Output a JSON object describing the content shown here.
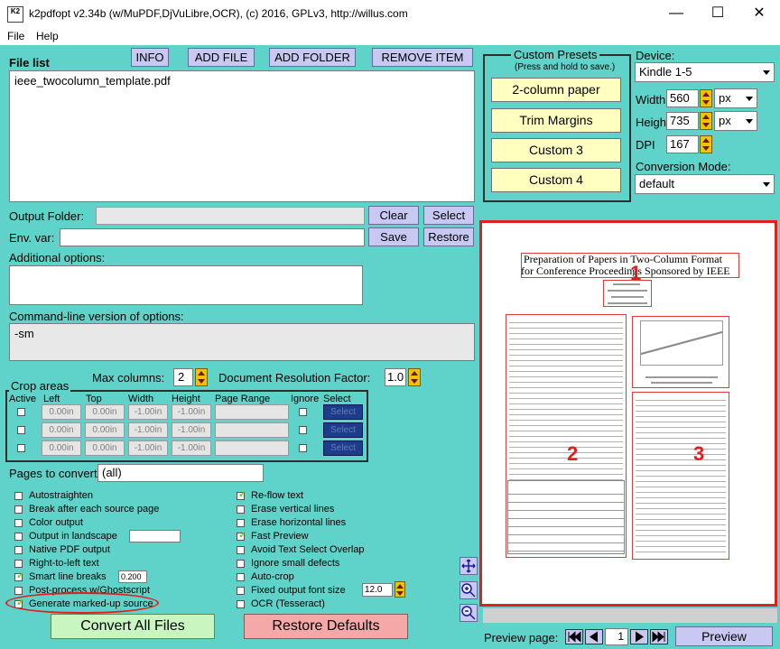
{
  "window": {
    "title": "k2pdfopt v2.34b (w/MuPDF,DjVuLibre,OCR), (c) 2016, GPLv3, http://willus.com",
    "icon": "K2",
    "controls": {
      "minimize": "—",
      "maximize": "☐",
      "close": "✕"
    }
  },
  "menu": {
    "file": "File",
    "help": "Help"
  },
  "toolbar": {
    "file_list_label": "File list",
    "info": "INFO",
    "add_file": "ADD FILE",
    "add_folder": "ADD FOLDER",
    "remove_item": "REMOVE ITEM"
  },
  "file_list": [
    "ieee_twocolumn_template.pdf"
  ],
  "output_folder": {
    "label": "Output Folder:",
    "value": "",
    "clear": "Clear",
    "select": "Select"
  },
  "env_var": {
    "label": "Env. var:",
    "value": "",
    "save": "Save",
    "restore": "Restore"
  },
  "additional_options": {
    "label": "Additional options:",
    "value": ""
  },
  "command_line": {
    "label": "Command-line version of options:",
    "value": "-sm"
  },
  "columns": {
    "max_label": "Max columns:",
    "max_value": "2",
    "res_label": "Document Resolution Factor:",
    "res_value": "1.0"
  },
  "crop": {
    "title": "Crop areas",
    "headers": {
      "active": "Active",
      "left": "Left",
      "top": "Top",
      "width": "Width",
      "height": "Height",
      "page_range": "Page Range",
      "ignore": "Ignore",
      "select": "Select"
    },
    "rows": [
      {
        "left": "0.00in",
        "top": "0.00in",
        "width": "-1.00in",
        "height": "-1.00in",
        "page_range": "",
        "select": "Select"
      },
      {
        "left": "0.00in",
        "top": "0.00in",
        "width": "-1.00in",
        "height": "-1.00in",
        "page_range": "",
        "select": "Select"
      },
      {
        "left": "0.00in",
        "top": "0.00in",
        "width": "-1.00in",
        "height": "-1.00in",
        "page_range": "",
        "select": "Select"
      }
    ]
  },
  "pages": {
    "label": "Pages to convert:",
    "value": "(all)"
  },
  "options_left": [
    {
      "label": "Autostraighten",
      "checked": false
    },
    {
      "label": "Break after each source page",
      "checked": false
    },
    {
      "label": "Color output",
      "checked": false
    },
    {
      "label": "Output in landscape",
      "checked": false
    },
    {
      "label": "Native PDF output",
      "checked": false
    },
    {
      "label": "Right-to-left text",
      "checked": false
    },
    {
      "label": "Smart line breaks",
      "checked": true,
      "value": "0.200"
    },
    {
      "label": "Post-process w/Ghostscript",
      "checked": false
    },
    {
      "label": "Generate marked-up source",
      "checked": true
    }
  ],
  "options_right": [
    {
      "label": "Re-flow text",
      "checked": true
    },
    {
      "label": "Erase vertical lines",
      "checked": false
    },
    {
      "label": "Erase horizontal lines",
      "checked": false
    },
    {
      "label": "Fast Preview",
      "checked": true
    },
    {
      "label": "Avoid Text Select Overlap",
      "checked": false
    },
    {
      "label": "Ignore small defects",
      "checked": false
    },
    {
      "label": "Auto-crop",
      "checked": false
    },
    {
      "label": "Fixed output font size",
      "checked": false,
      "value": "12.0"
    },
    {
      "label": "OCR (Tesseract)",
      "checked": false
    }
  ],
  "actions": {
    "convert": "Convert All Files",
    "restore": "Restore Defaults"
  },
  "presets": {
    "title": "Custom Presets",
    "subtitle": "(Press and hold to save.)",
    "items": [
      "2-column paper",
      "Trim Margins",
      "Custom 3",
      "Custom 4"
    ]
  },
  "device": {
    "label": "Device:",
    "value": "Kindle 1-5",
    "width_label": "Width",
    "width_value": "560",
    "width_unit": "px",
    "height_label": "Height",
    "height_value": "735",
    "height_unit": "px",
    "dpi_label": "DPI",
    "dpi_value": "167",
    "mode_label": "Conversion Mode:",
    "mode_value": "default"
  },
  "preview": {
    "doc_title_line1": "Preparation of Papers in Two-Column Format",
    "doc_title_line2": "for Conference Proceedings Sponsored by IEEE",
    "region_numbers": [
      "1",
      "2",
      "3"
    ],
    "page_label": "Preview page:",
    "page_value": "1",
    "preview_button": "Preview"
  },
  "colors": {
    "background": "#5fd3c9",
    "button": "#c7c9f2",
    "preset": "#ffffc0",
    "highlight": "#e02020",
    "check": "#6ccc22"
  }
}
